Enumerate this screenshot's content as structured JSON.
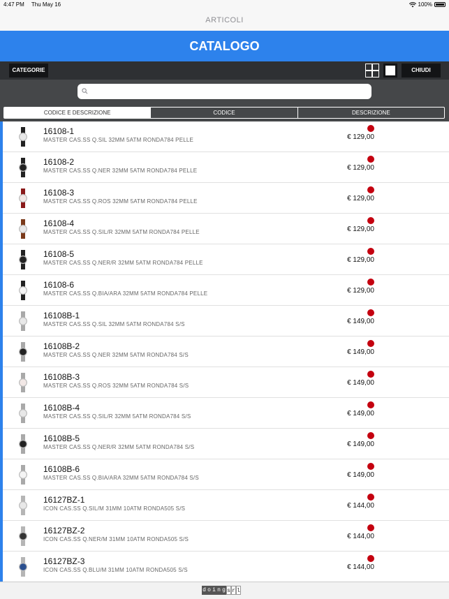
{
  "status": {
    "time": "4:47 PM",
    "date": "Thu May 16",
    "battery": "100%"
  },
  "nav": {
    "title": "ARTICOLI"
  },
  "header": {
    "title": "CATALOGO"
  },
  "toolbar": {
    "categories_label": "CATEGORIE",
    "close_label": "CHIUDI"
  },
  "search": {
    "value": ""
  },
  "segments": [
    "CODICE E DESCRIZIONE",
    "CODICE",
    "DESCRIZIONE"
  ],
  "colors": {
    "accent": "#2d82ec",
    "status_dot": "#c4000f",
    "toolbar": "#2e3033"
  },
  "items": [
    {
      "code": "16108-1",
      "desc": "MASTER CAS.SS Q.SIL 32MM 5ATM RONDA784 PELLE",
      "price": "€ 129,00",
      "dial": "#e8e8e8",
      "strap": "#222222"
    },
    {
      "code": "16108-2",
      "desc": "MASTER CAS.SS Q.NER 32MM 5ATM RONDA784 PELLE",
      "price": "€ 129,00",
      "dial": "#222222",
      "strap": "#222222"
    },
    {
      "code": "16108-3",
      "desc": "MASTER CAS.SS Q.ROS 32MM 5ATM RONDA784 PELLE",
      "price": "€ 129,00",
      "dial": "#f2e8e6",
      "strap": "#8a1a1a"
    },
    {
      "code": "16108-4",
      "desc": "MASTER CAS.SS Q.SIL/R 32MM 5ATM RONDA784 PELLE",
      "price": "€ 129,00",
      "dial": "#e8e8e8",
      "strap": "#7a3a1a"
    },
    {
      "code": "16108-5",
      "desc": "MASTER CAS.SS Q.NER/R 32MM 5ATM RONDA784 PELLE",
      "price": "€ 129,00",
      "dial": "#222222",
      "strap": "#222222"
    },
    {
      "code": "16108-6",
      "desc": "MASTER CAS.SS Q.BIA/ARA 32MM 5ATM RONDA784 PELLE",
      "price": "€ 129,00",
      "dial": "#f5f5f5",
      "strap": "#222222"
    },
    {
      "code": "16108B-1",
      "desc": "MASTER CAS.SS Q.SIL 32MM 5ATM RONDA784 S/S",
      "price": "€ 149,00",
      "dial": "#e8e8e8",
      "strap": "#a9a9a9"
    },
    {
      "code": "16108B-2",
      "desc": "MASTER CAS.SS Q.NER 32MM 5ATM RONDA784 S/S",
      "price": "€ 149,00",
      "dial": "#222222",
      "strap": "#a9a9a9"
    },
    {
      "code": "16108B-3",
      "desc": "MASTER CAS.SS Q.ROS 32MM 5ATM RONDA784 S/S",
      "price": "€ 149,00",
      "dial": "#f2e8e6",
      "strap": "#a9a9a9"
    },
    {
      "code": "16108B-4",
      "desc": "MASTER CAS.SS Q.SIL/R 32MM 5ATM RONDA784 S/S",
      "price": "€ 149,00",
      "dial": "#e8e8e8",
      "strap": "#a9a9a9"
    },
    {
      "code": "16108B-5",
      "desc": "MASTER CAS.SS Q.NER/R 32MM 5ATM RONDA784 S/S",
      "price": "€ 149,00",
      "dial": "#222222",
      "strap": "#a9a9a9"
    },
    {
      "code": "16108B-6",
      "desc": "MASTER CAS.SS Q.BIA/ARA 32MM 5ATM RONDA784 S/S",
      "price": "€ 149,00",
      "dial": "#f5f5f5",
      "strap": "#a9a9a9"
    },
    {
      "code": "16127BZ-1",
      "desc": "ICON CAS.SS Q.SIL/M 31MM 10ATM RONDA505 S/S",
      "price": "€ 144,00",
      "dial": "#e8e8e8",
      "strap": "#b5b5b5"
    },
    {
      "code": "16127BZ-2",
      "desc": "ICON CAS.SS Q.NER/M 31MM 10ATM RONDA505 S/S",
      "price": "€ 144,00",
      "dial": "#333333",
      "strap": "#b5b5b5"
    },
    {
      "code": "16127BZ-3",
      "desc": "ICON CAS.SS Q.BLU/M 31MM 10ATM RONDA505 S/S",
      "price": "€ 144,00",
      "dial": "#2a4f8f",
      "strap": "#b5b5b5"
    }
  ],
  "footer": {
    "logo_text": "doingsrl"
  }
}
